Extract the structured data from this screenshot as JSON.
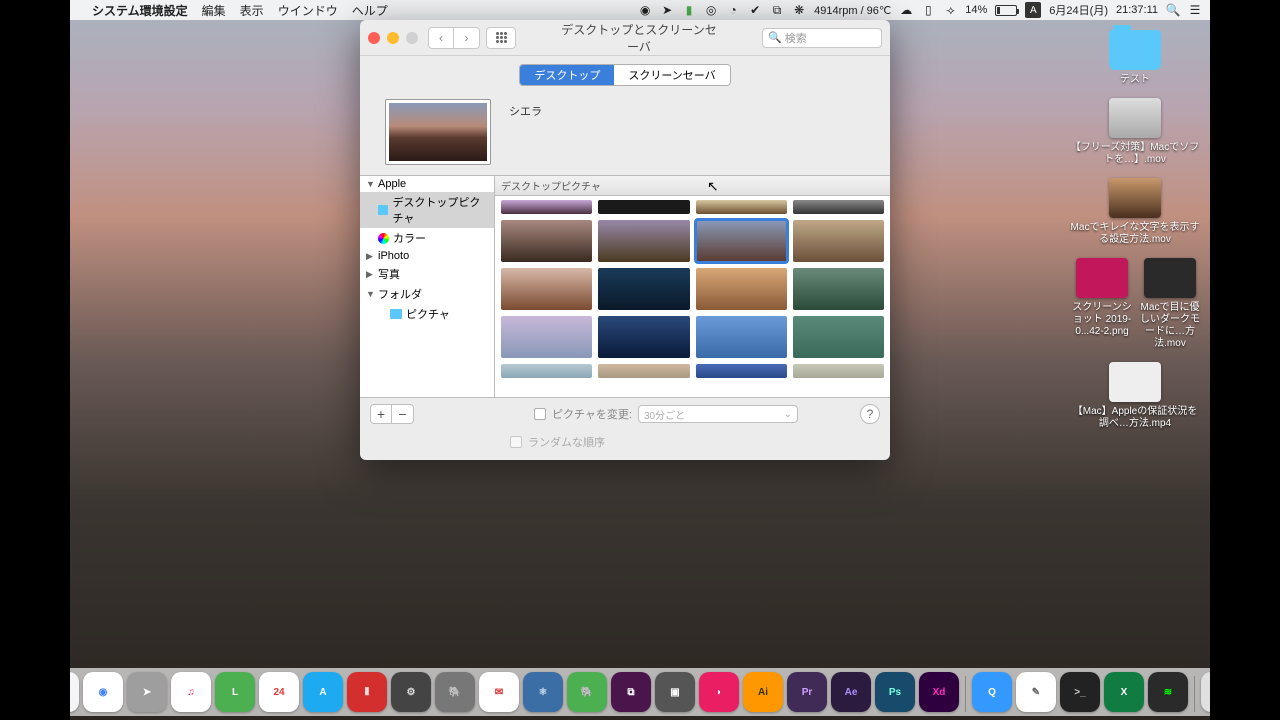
{
  "menubar": {
    "app": "システム環境設定",
    "items": [
      "編集",
      "表示",
      "ウインドウ",
      "ヘルプ"
    ],
    "status": {
      "fan_temp": "4914rpm / 96℃",
      "battery_pct": "14%",
      "date": "6月24日(月)",
      "time": "21:37:11",
      "ime": "A"
    }
  },
  "window": {
    "title": "デスクトップとスクリーンセーバ",
    "search_placeholder": "検索",
    "tabs": {
      "desktop": "デスクトップ",
      "screensaver": "スクリーンセーバ"
    },
    "preview_name": "シエラ",
    "sidebar": {
      "apple": "Apple",
      "desktop_pics": "デスクトップピクチャ",
      "color": "カラー",
      "iphoto": "iPhoto",
      "photos": "写真",
      "folder": "フォルダ",
      "pictures": "ピクチャ"
    },
    "thumbs_header": "デスクトップピクチャ",
    "change_label": "ピクチャを変更:",
    "interval": "30分ごと",
    "random_label": "ランダムな順序"
  },
  "desktop_icons": {
    "folder1": "テスト",
    "mov1": "【フリーズ対策】Macでソフトを…】.mov",
    "mov2": "Macでキレイな文字を表示する設定方法.mov",
    "shot": "スクリーンショット 2019-0...42-2.png",
    "mov3": "Macで目に優しいダークモードに…方法.mov",
    "mp4": "【Mac】Appleの保証状況を調べ…方法.mp4"
  },
  "dock": [
    {
      "bg": "#f5f5f7",
      "fg": "#1e88e5",
      "txt": "☺"
    },
    {
      "bg": "#fff",
      "fg": "#4285f4",
      "txt": "◉"
    },
    {
      "bg": "#9e9e9e",
      "fg": "#fff",
      "txt": "➤"
    },
    {
      "bg": "#fff",
      "fg": "#e91e63",
      "txt": "♫"
    },
    {
      "bg": "#4caf50",
      "fg": "#fff",
      "txt": "L"
    },
    {
      "bg": "#fff",
      "fg": "#e53935",
      "txt": "24"
    },
    {
      "bg": "#1eaaf1",
      "fg": "#fff",
      "txt": "A"
    },
    {
      "bg": "#d32f2f",
      "fg": "#fff",
      "txt": "⦀"
    },
    {
      "bg": "#444",
      "fg": "#ddd",
      "txt": "⚙"
    },
    {
      "bg": "#777",
      "fg": "#fff",
      "txt": "🐘"
    },
    {
      "bg": "#fff",
      "fg": "#d32f2f",
      "txt": "✉"
    },
    {
      "bg": "#3a6ea5",
      "fg": "#cde",
      "txt": "⚛"
    },
    {
      "bg": "#4caf50",
      "fg": "#fff",
      "txt": "🐘"
    },
    {
      "bg": "#4a154b",
      "fg": "#fff",
      "txt": "⧉"
    },
    {
      "bg": "#555",
      "fg": "#fff",
      "txt": "▣"
    },
    {
      "bg": "#e91e63",
      "fg": "#fff",
      "txt": "◗"
    },
    {
      "bg": "#ff9800",
      "fg": "#330",
      "txt": "Ai"
    },
    {
      "bg": "#3f2b56",
      "fg": "#d0a0ff",
      "txt": "Pr"
    },
    {
      "bg": "#2b1b3f",
      "fg": "#b090ff",
      "txt": "Ae"
    },
    {
      "bg": "#184a6b",
      "fg": "#7fd",
      "txt": "Ps"
    },
    {
      "bg": "#2e003e",
      "fg": "#ff2bc2",
      "txt": "Xd"
    },
    {
      "bg": "#3399ff",
      "fg": "#fff",
      "txt": "Q"
    },
    {
      "bg": "#fff",
      "fg": "#666",
      "txt": "✎"
    },
    {
      "bg": "#222",
      "fg": "#ccc",
      "txt": ">_"
    },
    {
      "bg": "#107c41",
      "fg": "#fff",
      "txt": "X"
    },
    {
      "bg": "#2a2a2a",
      "fg": "#0f0",
      "txt": "≋"
    },
    {
      "bg": "#e0e0e0",
      "fg": "#888",
      "txt": "🗑"
    }
  ]
}
